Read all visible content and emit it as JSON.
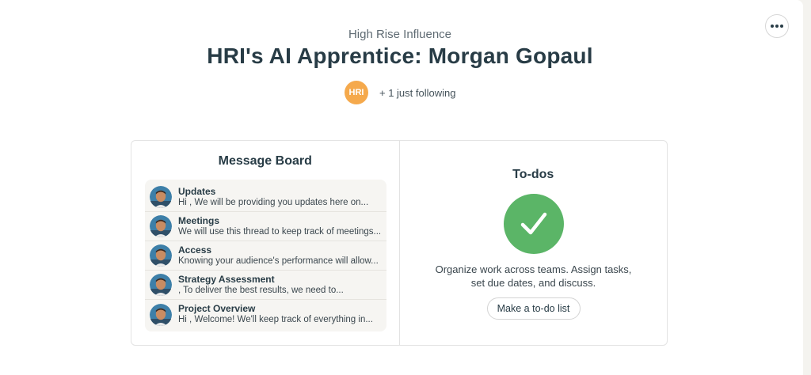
{
  "project": {
    "company": "High Rise Influence",
    "title": "HRI's AI Apprentice: Morgan Gopaul",
    "avatar_initials": "HRI",
    "following_text": "+ 1 just following",
    "avatar_color": "#f5a94c"
  },
  "more_button": {
    "icon": "ellipsis-icon"
  },
  "message_board": {
    "title": "Message Board",
    "messages": [
      {
        "subject": "Updates",
        "excerpt": "Hi , We will be providing you updates here on..."
      },
      {
        "subject": "Meetings",
        "excerpt": "We will use this thread to keep track of meetings..."
      },
      {
        "subject": "Access",
        "excerpt": "Knowing your audience's performance will allow..."
      },
      {
        "subject": "Strategy Assessment",
        "excerpt": ", To deliver the best results, we need to..."
      },
      {
        "subject": "Project Overview",
        "excerpt": "Hi , Welcome! We'll keep track of everything in..."
      }
    ]
  },
  "todos": {
    "title": "To-dos",
    "description": "Organize work across teams. Assign tasks, set due dates, and discuss.",
    "button_label": "Make a to-do list",
    "check_color": "#5bb567"
  }
}
